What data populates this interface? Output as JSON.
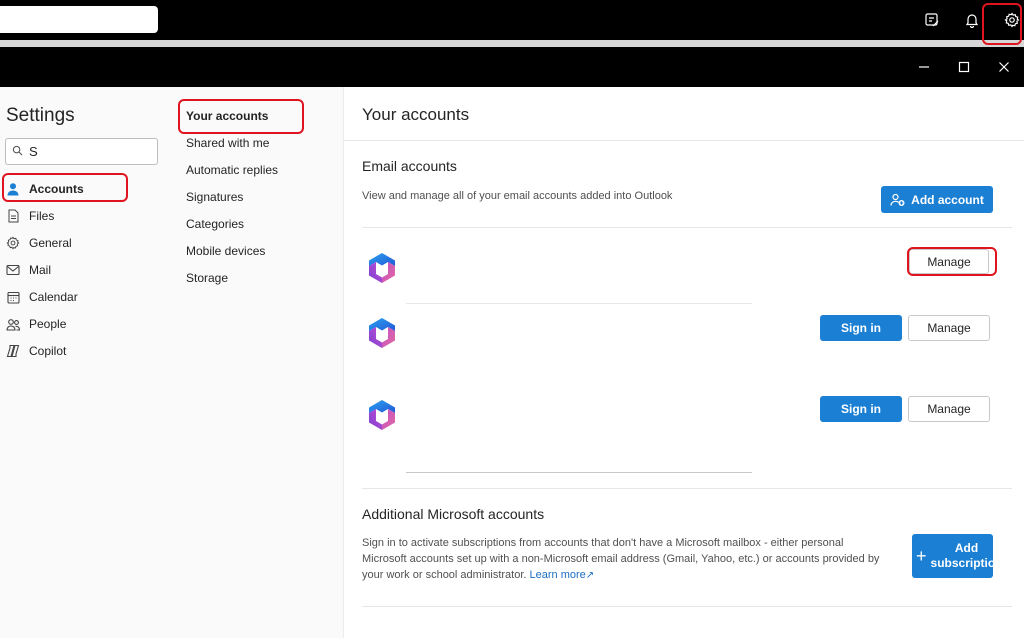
{
  "search": {
    "value": "S"
  },
  "settings": {
    "title": "Settings"
  },
  "sidebar": {
    "items": [
      {
        "label": "Accounts",
        "icon": "person-icon"
      },
      {
        "label": "Files",
        "icon": "file-icon"
      },
      {
        "label": "General",
        "icon": "gear-icon"
      },
      {
        "label": "Mail",
        "icon": "mail-icon"
      },
      {
        "label": "Calendar",
        "icon": "calendar-icon"
      },
      {
        "label": "People",
        "icon": "people-icon"
      },
      {
        "label": "Copilot",
        "icon": "copilot-icon"
      }
    ]
  },
  "subnav": {
    "items": [
      {
        "label": "Your accounts"
      },
      {
        "label": "Shared with me"
      },
      {
        "label": "Automatic replies"
      },
      {
        "label": "Signatures"
      },
      {
        "label": "Categories"
      },
      {
        "label": "Mobile devices"
      },
      {
        "label": "Storage"
      }
    ]
  },
  "main": {
    "title": "Your accounts",
    "email": {
      "title": "Email accounts",
      "description": "View and manage all of your email accounts added into Outlook",
      "add_label": "Add account",
      "sign_in_label": "Sign in",
      "manage_label": "Manage"
    },
    "additional": {
      "title": "Additional Microsoft accounts",
      "description": "Sign in to activate subscriptions from accounts that don't have a Microsoft mailbox - either personal Microsoft accounts set up with a non-Microsoft email address (Gmail, Yahoo, etc.) or accounts provided by your work or school administrator.",
      "learn_more": "Learn more",
      "add_line1": "Add",
      "add_line2": "subscription"
    }
  },
  "colors": {
    "accent": "#1b7fd4",
    "highlight": "#e0141e"
  }
}
